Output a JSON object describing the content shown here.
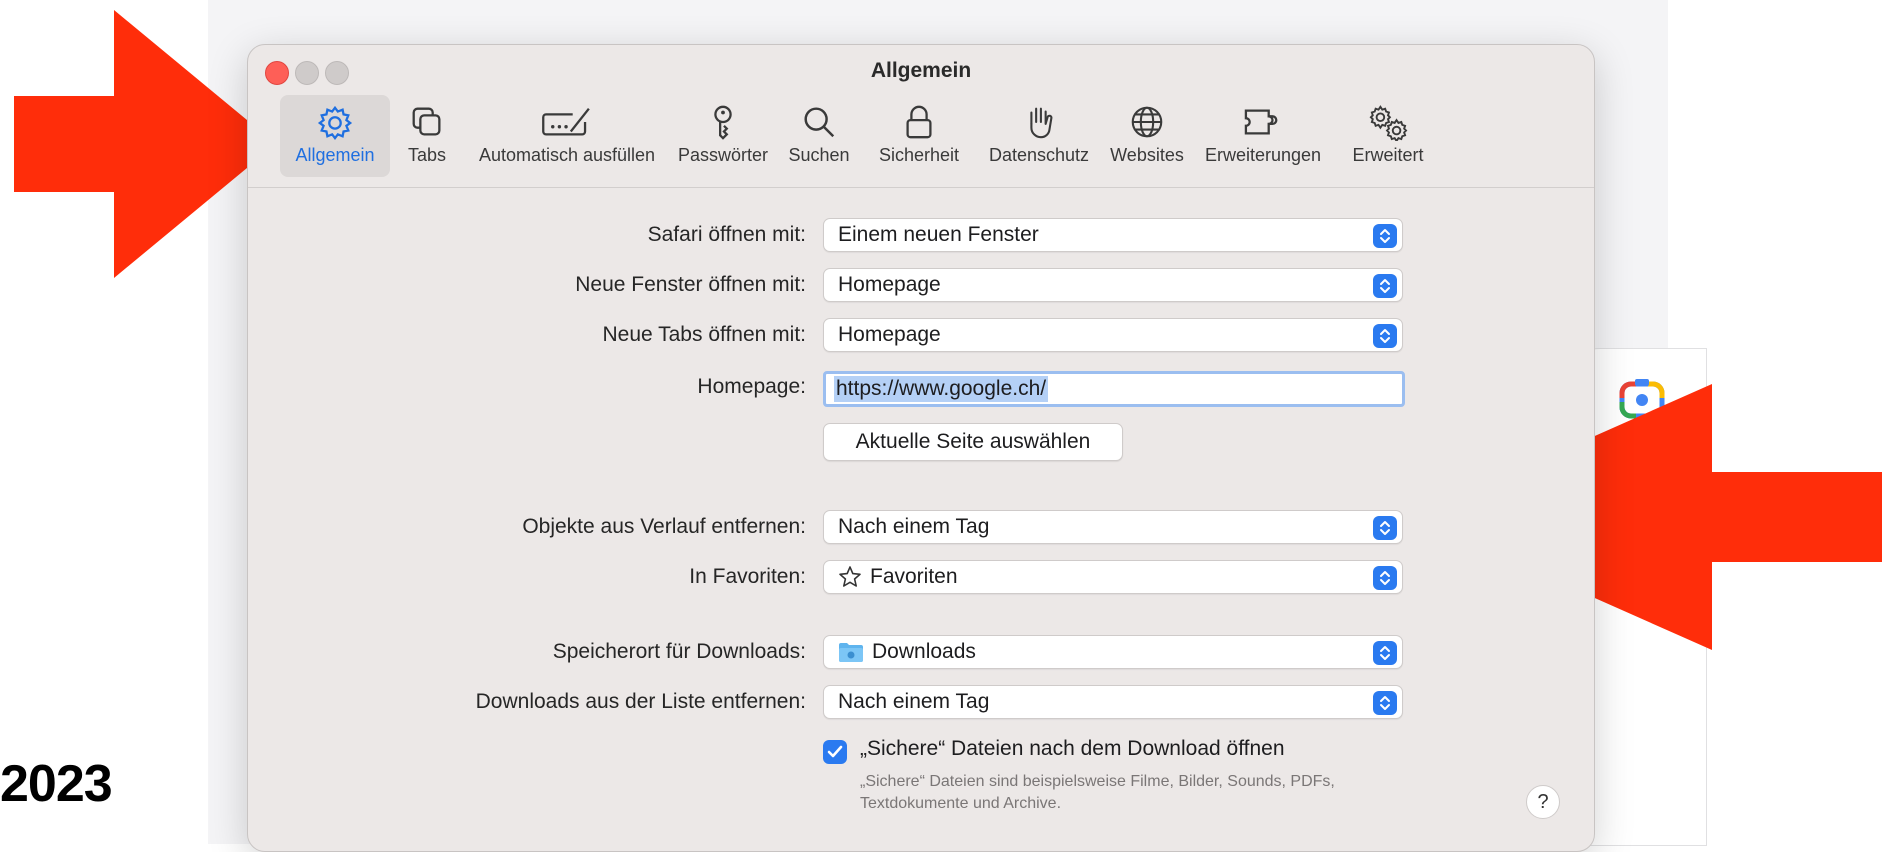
{
  "year_label": "2023",
  "window": {
    "title": "Allgemein"
  },
  "toolbar": [
    {
      "label": "Allgemein",
      "icon": "gear-icon",
      "active": true
    },
    {
      "label": "Tabs",
      "icon": "tabs-icon"
    },
    {
      "label": "Automatisch ausfüllen",
      "icon": "autofill-icon"
    },
    {
      "label": "Passwörter",
      "icon": "key-icon"
    },
    {
      "label": "Suchen",
      "icon": "search-icon"
    },
    {
      "label": "Sicherheit",
      "icon": "lock-icon"
    },
    {
      "label": "Datenschutz",
      "icon": "hand-icon"
    },
    {
      "label": "Websites",
      "icon": "globe-icon"
    },
    {
      "label": "Erweiterungen",
      "icon": "extension-icon"
    },
    {
      "label": "Erweitert",
      "icon": "gears-icon"
    }
  ],
  "settings": {
    "safari_open": {
      "label": "Safari öffnen mit:",
      "value": "Einem neuen Fenster"
    },
    "new_windows": {
      "label": "Neue Fenster öffnen mit:",
      "value": "Homepage"
    },
    "new_tabs": {
      "label": "Neue Tabs öffnen mit:",
      "value": "Homepage"
    },
    "homepage": {
      "label": "Homepage:",
      "value": "https://www.google.ch/"
    },
    "set_current_page": {
      "label": "Aktuelle Seite auswählen"
    },
    "remove_history": {
      "label": "Objekte aus Verlauf entfernen:",
      "value": "Nach einem Tag"
    },
    "favorites": {
      "label": "In Favoriten:",
      "value": "Favoriten"
    },
    "download_location": {
      "label": "Speicherort für Downloads:",
      "value": "Downloads"
    },
    "remove_downloads": {
      "label": "Downloads aus der Liste entfernen:",
      "value": "Nach einem Tag"
    },
    "open_safe_files": {
      "label": "„Sichere“ Dateien nach dem Download öffnen",
      "checked": true,
      "hint": "„Sichere“ Dateien sind beispielsweise Filme, Bilder, Sounds, PDFs, Textdokumente und Archive."
    },
    "help": {
      "label": "?"
    }
  },
  "colors": {
    "accent": "#2a7af0",
    "annotation_arrow": "#ff2d0a",
    "close_button": "#fe5f57"
  }
}
